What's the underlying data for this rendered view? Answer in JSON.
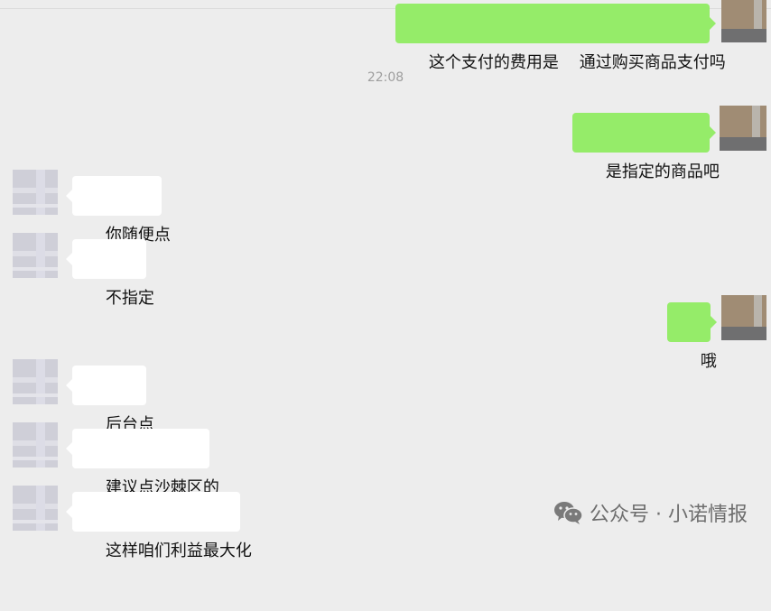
{
  "chat": {
    "timestamp": "22:08",
    "messages": [
      {
        "side": "right",
        "text": "这个支付的费用是    通过购买商品支付吗"
      },
      {
        "side": "right",
        "text": "是指定的商品吧"
      },
      {
        "side": "left",
        "text": "你随便点"
      },
      {
        "side": "left",
        "text": "不指定"
      },
      {
        "side": "right",
        "text": "哦"
      },
      {
        "side": "left",
        "text": "后台点"
      },
      {
        "side": "left",
        "text": "建议点沙棘区的"
      },
      {
        "side": "left",
        "text": "这样咱们利益最大化"
      }
    ]
  },
  "watermark": {
    "text": "公众号 · 小诺情报",
    "icon": "wechat-icon"
  },
  "colors": {
    "background": "#ededed",
    "self_bubble": "#95ec69",
    "other_bubble": "#ffffff"
  }
}
